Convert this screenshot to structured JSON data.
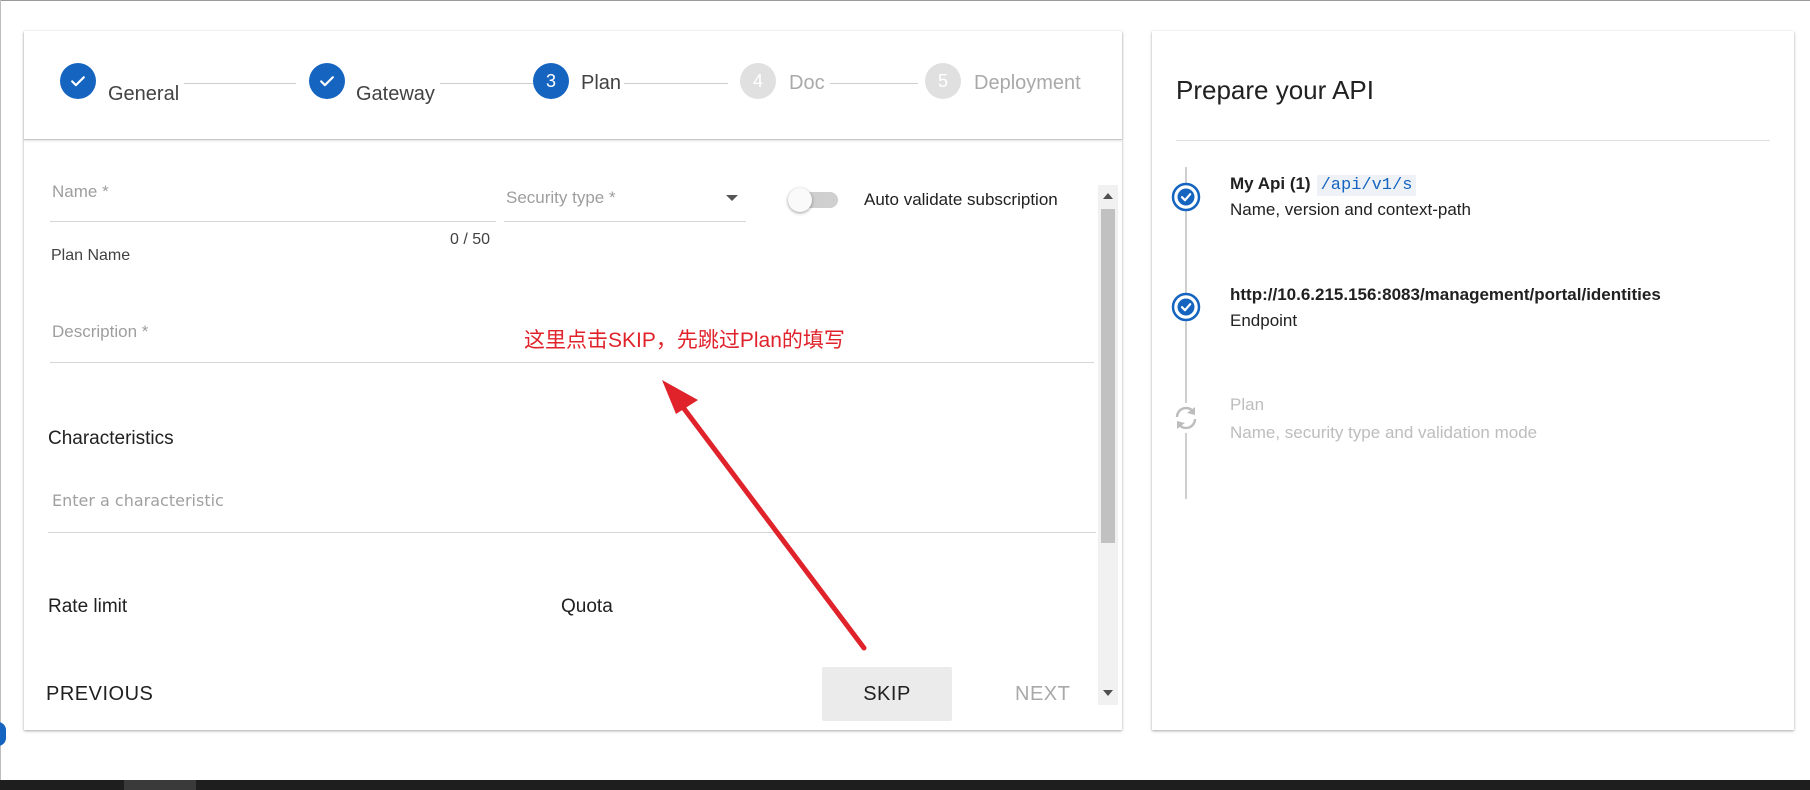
{
  "stepper": {
    "steps": [
      {
        "label": "General",
        "state": "done"
      },
      {
        "label": "Gateway",
        "state": "done"
      },
      {
        "label": "Plan",
        "number": "3",
        "state": "active"
      },
      {
        "label": "Doc",
        "number": "4",
        "state": "inactive"
      },
      {
        "label": "Deployment",
        "number": "5",
        "state": "inactive"
      }
    ]
  },
  "form": {
    "name_placeholder": "Name *",
    "name_counter": "0 / 50",
    "name_hint": "Plan Name",
    "security_placeholder": "Security type *",
    "auto_validate_label": "Auto validate subscription",
    "auto_validate_enabled": false,
    "description_placeholder": "Description *",
    "characteristics_title": "Characteristics",
    "characteristic_placeholder": "Enter a characteristic",
    "rate_limit_title": "Rate limit",
    "quota_title": "Quota"
  },
  "actions": {
    "previous": "PREVIOUS",
    "skip": "SKIP",
    "next": "NEXT"
  },
  "annotation": {
    "text": "这里点击SKIP，先跳过Plan的填写",
    "color": "#e0222b"
  },
  "summary": {
    "title": "Prepare your API",
    "items": [
      {
        "title": "My Api (1)",
        "code": "/api/v1/s",
        "subtitle": "Name, version and context-path",
        "state": "done"
      },
      {
        "title": "http://10.6.215.156:8083/management/portal/identities",
        "subtitle": "Endpoint",
        "state": "done"
      },
      {
        "title": "Plan",
        "subtitle": "Name, security type and validation mode",
        "state": "pending"
      }
    ]
  },
  "colors": {
    "primary": "#1565c0",
    "inactive_step": "#e0e0e0",
    "muted_text": "#bdbdbd"
  }
}
